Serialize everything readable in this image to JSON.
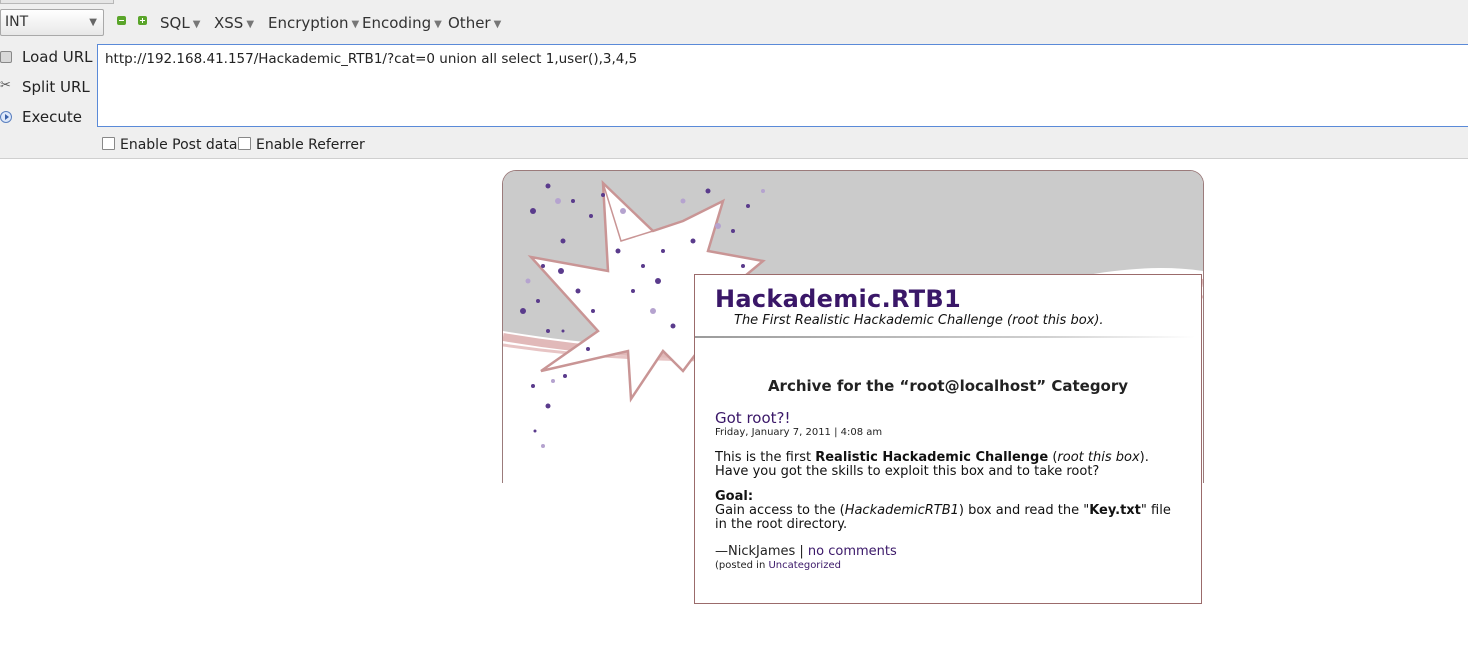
{
  "hackbar": {
    "type_select_value": "INT",
    "menus": [
      "SQL",
      "XSS",
      "Encryption",
      "Encoding",
      "Other"
    ],
    "actions": {
      "load": "Load URL",
      "split": "Split URL",
      "execute": "Execute"
    },
    "url_value": "http://192.168.41.157/Hackademic_RTB1/?cat=0 union all select 1,user(),3,4,5",
    "checkboxes": {
      "post": "Enable Post data",
      "referrer": "Enable Referrer"
    }
  },
  "blog": {
    "title": "Hackademic.RTB1",
    "description": "The First Realistic Hackademic Challenge (root this box).",
    "archive_heading": "Archive for the “root@localhost” Category",
    "post": {
      "title": "Got root?!",
      "date": "Friday, January 7, 2011 | 4:08 am",
      "intro_1": "This is the first ",
      "intro_bold": "Realistic Hackademic Challenge",
      "intro_2": " (",
      "intro_italic": "root this box",
      "intro_3": ").",
      "intro_line2": "Have you got the skills to exploit this box and to take root?",
      "goal_label": "Goal:",
      "goal_1": "Gain access to the (",
      "goal_italic": "HackademicRTB1",
      "goal_2": ") box and read the \"",
      "goal_bold": "Key.txt",
      "goal_3": "\" file in the root directory.",
      "author": "—NickJames | ",
      "comments_link": "no comments",
      "category_prefix": "(posted in ",
      "category_link": "Uncategorized"
    }
  },
  "colors": {
    "title": "#3a1768",
    "url_border": "#5a8ad8"
  }
}
